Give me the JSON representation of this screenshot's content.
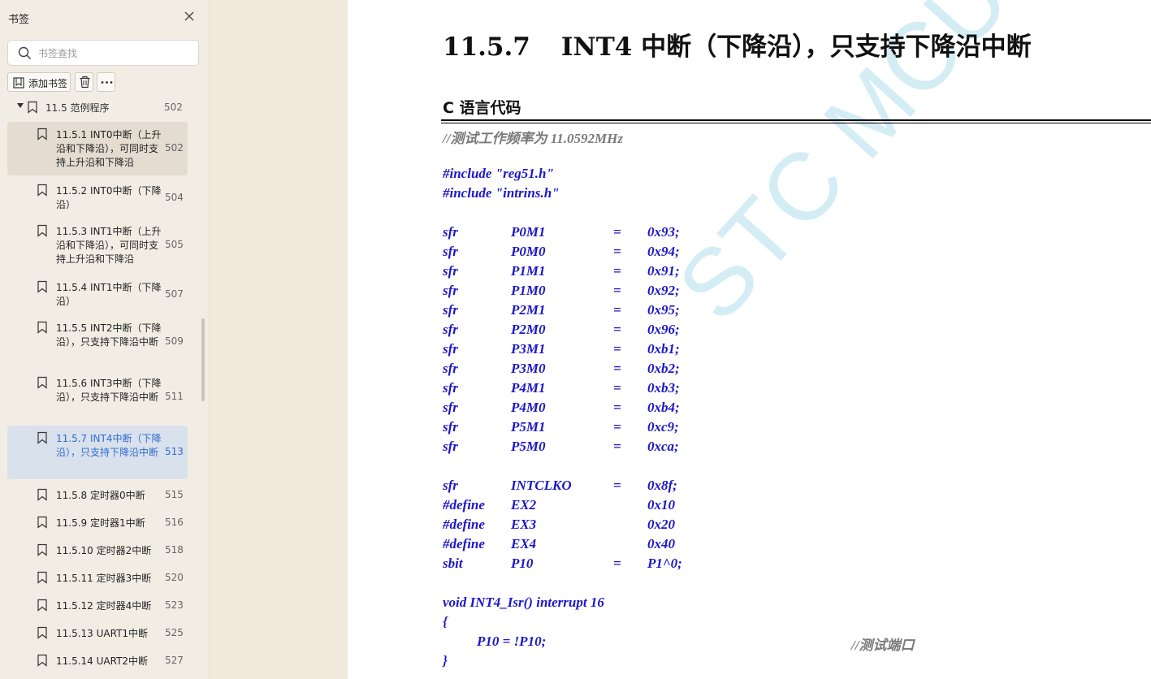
{
  "sidebar": {
    "title": "书签",
    "search": {
      "placeholder": "书签查找",
      "value": ""
    },
    "toolbar": {
      "add_label": "添加书签"
    },
    "parent": {
      "label": "11.5 范例程序",
      "page": "502"
    },
    "items": [
      {
        "label": "11.5.1 INT0中断（上升沿和下降沿），可同时支持上升沿和下降沿",
        "page": "502"
      },
      {
        "label": "11.5.2 INT0中断（下降沿）",
        "page": "504"
      },
      {
        "label": "11.5.3 INT1中断（上升沿和下降沿），可同时支持上升沿和下降沿",
        "page": "505"
      },
      {
        "label": "11.5.4 INT1中断（下降沿）",
        "page": "507"
      },
      {
        "label": "11.5.5 INT2中断（下降沿），只支持下降沿中断",
        "page": "509"
      },
      {
        "label": "11.5.6 INT3中断（下降沿），只支持下降沿中断",
        "page": "511"
      },
      {
        "label": "11.5.7 INT4中断（下降沿），只支持下降沿中断",
        "page": "513"
      },
      {
        "label": "11.5.8 定时器0中断",
        "page": "515"
      },
      {
        "label": "11.5.9 定时器1中断",
        "page": "516"
      },
      {
        "label": "11.5.10 定时器2中断",
        "page": "518"
      },
      {
        "label": "11.5.11 定时器3中断",
        "page": "520"
      },
      {
        "label": "11.5.12 定时器4中断",
        "page": "523"
      },
      {
        "label": "11.5.13 UART1中断",
        "page": "525"
      },
      {
        "label": "11.5.14 UART2中断",
        "page": "527"
      }
    ]
  },
  "document": {
    "section_number": "11.5.7",
    "section_title": "INT4 中断（下降沿），只支持下降沿中断",
    "code_heading": "C 语言代码",
    "watermark": "STC MCU",
    "code": {
      "comment_freq": "//测试工作频率为 11.0592MHz",
      "includes": [
        "#include \"reg51.h\"",
        "#include \"intrins.h\""
      ],
      "sfr_defs": [
        [
          "sfr",
          "P0M1",
          "=",
          "0x93;"
        ],
        [
          "sfr",
          "P0M0",
          "=",
          "0x94;"
        ],
        [
          "sfr",
          "P1M1",
          "=",
          "0x91;"
        ],
        [
          "sfr",
          "P1M0",
          "=",
          "0x92;"
        ],
        [
          "sfr",
          "P2M1",
          "=",
          "0x95;"
        ],
        [
          "sfr",
          "P2M0",
          "=",
          "0x96;"
        ],
        [
          "sfr",
          "P3M1",
          "=",
          "0xb1;"
        ],
        [
          "sfr",
          "P3M0",
          "=",
          "0xb2;"
        ],
        [
          "sfr",
          "P4M1",
          "=",
          "0xb3;"
        ],
        [
          "sfr",
          "P4M0",
          "=",
          "0xb4;"
        ],
        [
          "sfr",
          "P5M1",
          "=",
          "0xc9;"
        ],
        [
          "sfr",
          "P5M0",
          "=",
          "0xca;"
        ]
      ],
      "extra_defs": [
        [
          "sfr",
          "INTCLKO",
          "=",
          "0x8f;"
        ],
        [
          "#define",
          "EX2",
          "",
          "0x10"
        ],
        [
          "#define",
          "EX3",
          "",
          "0x20"
        ],
        [
          "#define",
          "EX4",
          "",
          "0x40"
        ],
        [
          "sbit",
          "P10",
          "=",
          "P1^0;"
        ]
      ],
      "isr_signature": "void INT4_Isr() interrupt 16",
      "open_brace": "{",
      "isr_body": "P10 = !P10;",
      "isr_comment": "//测试端口",
      "close_brace": "}"
    }
  }
}
